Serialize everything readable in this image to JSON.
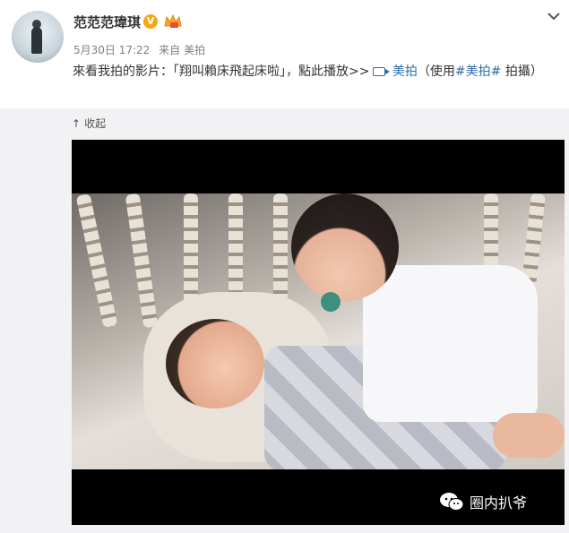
{
  "post": {
    "username": "范范范瑋琪",
    "verified_badge": "V",
    "meta": {
      "date": "5月30日 17:22",
      "from_label": "来自",
      "source": "美拍"
    },
    "text_main": "來看我拍的影片：「翔叫賴床飛起床啦」，點此播放>>",
    "link_label": "美拍",
    "text_paren_open": "（使用",
    "hashtag": "#美拍#",
    "text_tail": " 拍攝）"
  },
  "collapse": {
    "label": "收起"
  },
  "video": {
    "watermark": "圈内扒爷"
  },
  "colors": {
    "link": "#2e6ea5",
    "badge": "#f3a712",
    "panel_bg": "#f2f2f5"
  },
  "icons": [
    "verified-v-icon",
    "crown-badge-icon",
    "chevron-down-icon",
    "video-camera-icon",
    "collapse-arrow-icon",
    "wechat-icon"
  ]
}
